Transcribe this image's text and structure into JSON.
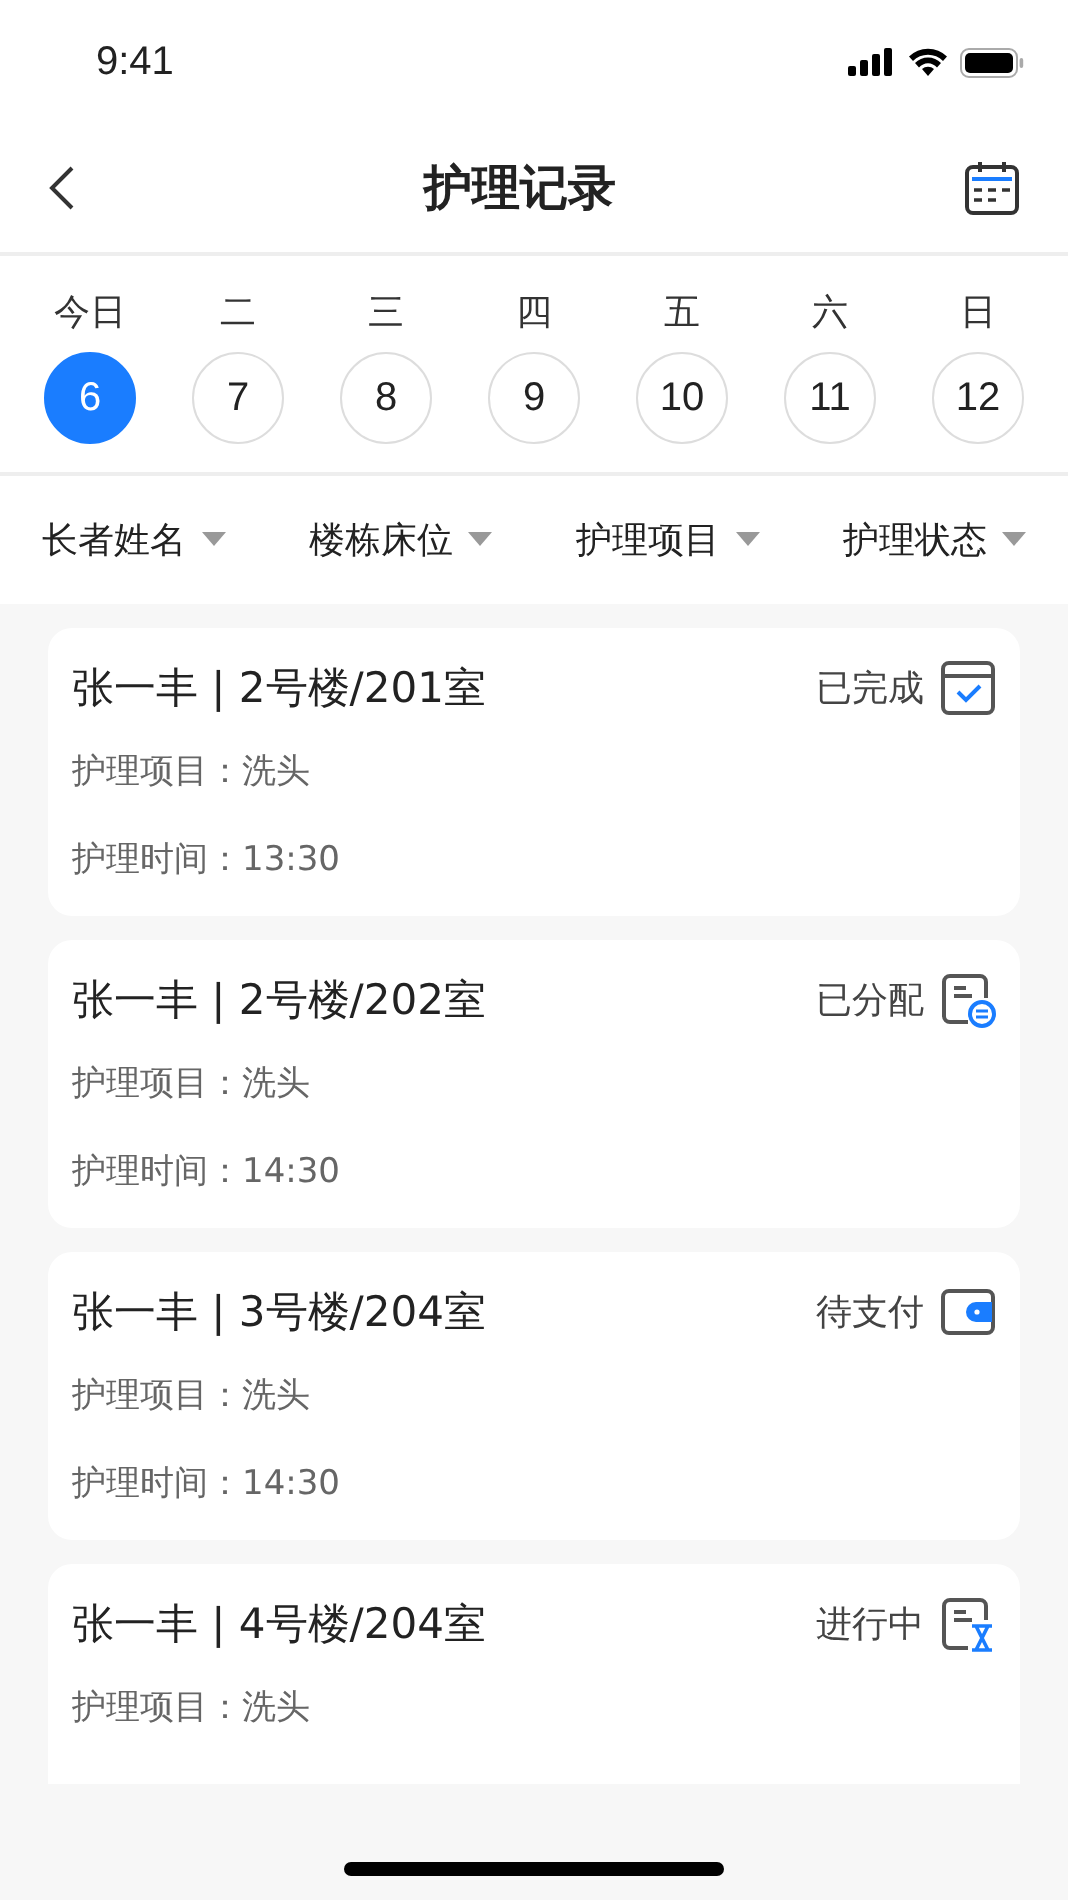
{
  "status_bar": {
    "time": "9:41"
  },
  "nav": {
    "title": "护理记录"
  },
  "week": [
    {
      "weekday": "今日",
      "date": "6",
      "selected": true
    },
    {
      "weekday": "二",
      "date": "7",
      "selected": false
    },
    {
      "weekday": "三",
      "date": "8",
      "selected": false
    },
    {
      "weekday": "四",
      "date": "9",
      "selected": false
    },
    {
      "weekday": "五",
      "date": "10",
      "selected": false
    },
    {
      "weekday": "六",
      "date": "11",
      "selected": false
    },
    {
      "weekday": "日",
      "date": "12",
      "selected": false
    }
  ],
  "filters": [
    "长者姓名",
    "楼栋床位",
    "护理项目",
    "护理状态"
  ],
  "records": [
    {
      "title": "张一丰 | 2号楼/201室",
      "status": "已完成",
      "kind": "done",
      "item": "护理项目：洗头",
      "time": "护理时间：13:30"
    },
    {
      "title": "张一丰 | 2号楼/202室",
      "status": "已分配",
      "kind": "assigned",
      "item": "护理项目：洗头",
      "time": "护理时间：14:30"
    },
    {
      "title": "张一丰 | 3号楼/204室",
      "status": "待支付",
      "kind": "unpaid",
      "item": "护理项目：洗头",
      "time": "护理时间：14:30"
    },
    {
      "title": "张一丰 | 4号楼/204室",
      "status": "进行中",
      "kind": "in_progress",
      "item": "护理项目：洗头"
    }
  ]
}
